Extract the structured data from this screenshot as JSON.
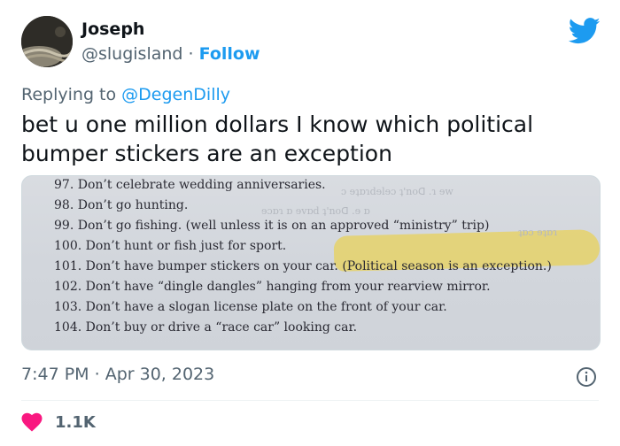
{
  "author": {
    "name": "Joseph",
    "handle": "@slugisland",
    "separator": "·",
    "follow_label": "Follow"
  },
  "reply": {
    "prefix": "Replying to",
    "mention": "@DegenDilly"
  },
  "tweet": {
    "text": "bet u one million dollars I know which political bumper stickers are an exception"
  },
  "photo": {
    "lines": [
      "97. Don’t celebrate wedding anniversaries.",
      "98. Don’t go hunting.",
      "99. Don’t go fishing. (well unless it is on an approved “ministry” trip)",
      "100. Don’t hunt or fish just for sport.",
      "101. Don’t have bumper stickers on your car. (Political season is an exception.)",
      "102. Don’t have “dingle dangles” hanging from your rearview mirror.",
      "103. Don’t have a slogan license plate on the front of your car.",
      "104. Don’t buy or drive a “race car” looking car."
    ],
    "highlight_color": "#e8d25a"
  },
  "meta": {
    "time": "7:47 PM",
    "separator": "·",
    "date": "Apr 30, 2023"
  },
  "engagement": {
    "likes": "1.1K"
  },
  "colors": {
    "text": "#0f1419",
    "secondary": "#536471",
    "accent": "#1d9bf0",
    "heart": "#f91880"
  },
  "icons": {
    "brand": "twitter-bird-icon",
    "info": "info-icon",
    "like": "heart-icon"
  }
}
